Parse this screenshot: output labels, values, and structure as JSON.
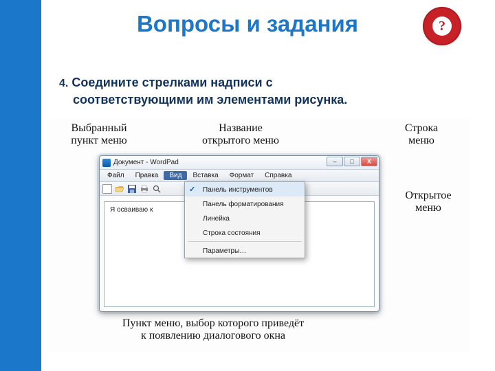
{
  "slide": {
    "title": "Вопросы и задания",
    "badge": "?",
    "question_number": "4.",
    "question_line1": "Соедините стрелками надписи с",
    "question_line2": "соответствующими им элементами рисунка."
  },
  "annotations": {
    "selected_menu_item": "Выбранный\nпункт меню",
    "open_menu_title": "Название\nоткрытого меню",
    "menu_bar": "Строка\nменю",
    "open_menu": "Открытое\nменю",
    "dialog_item": "Пункт меню, выбор которого приведёт\nк появлению диалогового окна"
  },
  "window": {
    "title": "Документ - WordPad",
    "minimize": "–",
    "maximize": "□",
    "close": "X",
    "menu": [
      "Файл",
      "Правка",
      "Вид",
      "Вставка",
      "Формат",
      "Справка"
    ],
    "active_menu_index": 2,
    "document_text": "Я осваиваю к"
  },
  "dropdown": {
    "items": [
      {
        "label": "Панель инструментов",
        "checked": true
      },
      {
        "label": "Панель форматирования",
        "checked": false
      },
      {
        "label": "Линейка",
        "checked": false
      },
      {
        "label": "Строка состояния",
        "checked": false
      }
    ],
    "last_item": "Параметры…"
  }
}
